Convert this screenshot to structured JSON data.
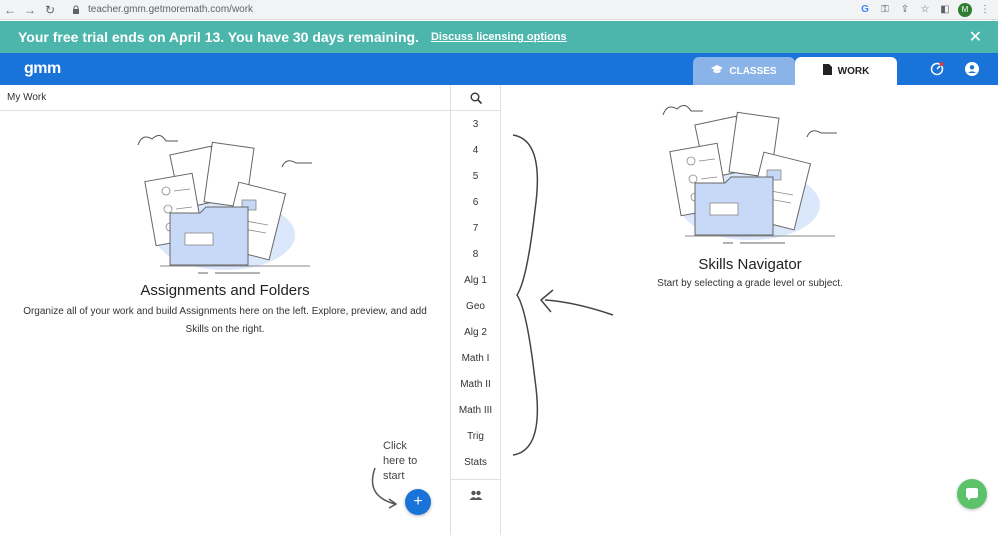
{
  "browser": {
    "url": "teacher.gmm.getmoremath.com/work",
    "profile_initial": "M"
  },
  "banner": {
    "text": "Your free trial ends on April 13. You have 30 days remaining.",
    "link": "Discuss licensing options",
    "close": "✕",
    "color": "#4db6ac"
  },
  "header": {
    "logo": "gmm",
    "tabs": [
      {
        "label": "CLASSES",
        "icon": "graduation-cap-icon"
      },
      {
        "label": "WORK",
        "icon": "document-icon"
      }
    ],
    "color": "#1a73d9"
  },
  "left_panel": {
    "breadcrumb": "My Work",
    "title": "Assignments and Folders",
    "description": "Organize all of your work and build Assignments here on the left. Explore, preview, and add Skills on the right.",
    "hint": [
      "Click",
      "here to",
      "start"
    ],
    "add_label": "+"
  },
  "grades": {
    "items": [
      "3",
      "4",
      "5",
      "6",
      "7",
      "8",
      "Alg 1",
      "Geo",
      "Alg 2",
      "Math I",
      "Math II",
      "Math III",
      "Trig",
      "Stats"
    ]
  },
  "right_panel": {
    "title": "Skills Navigator",
    "description": "Start by selecting a grade level or subject."
  }
}
